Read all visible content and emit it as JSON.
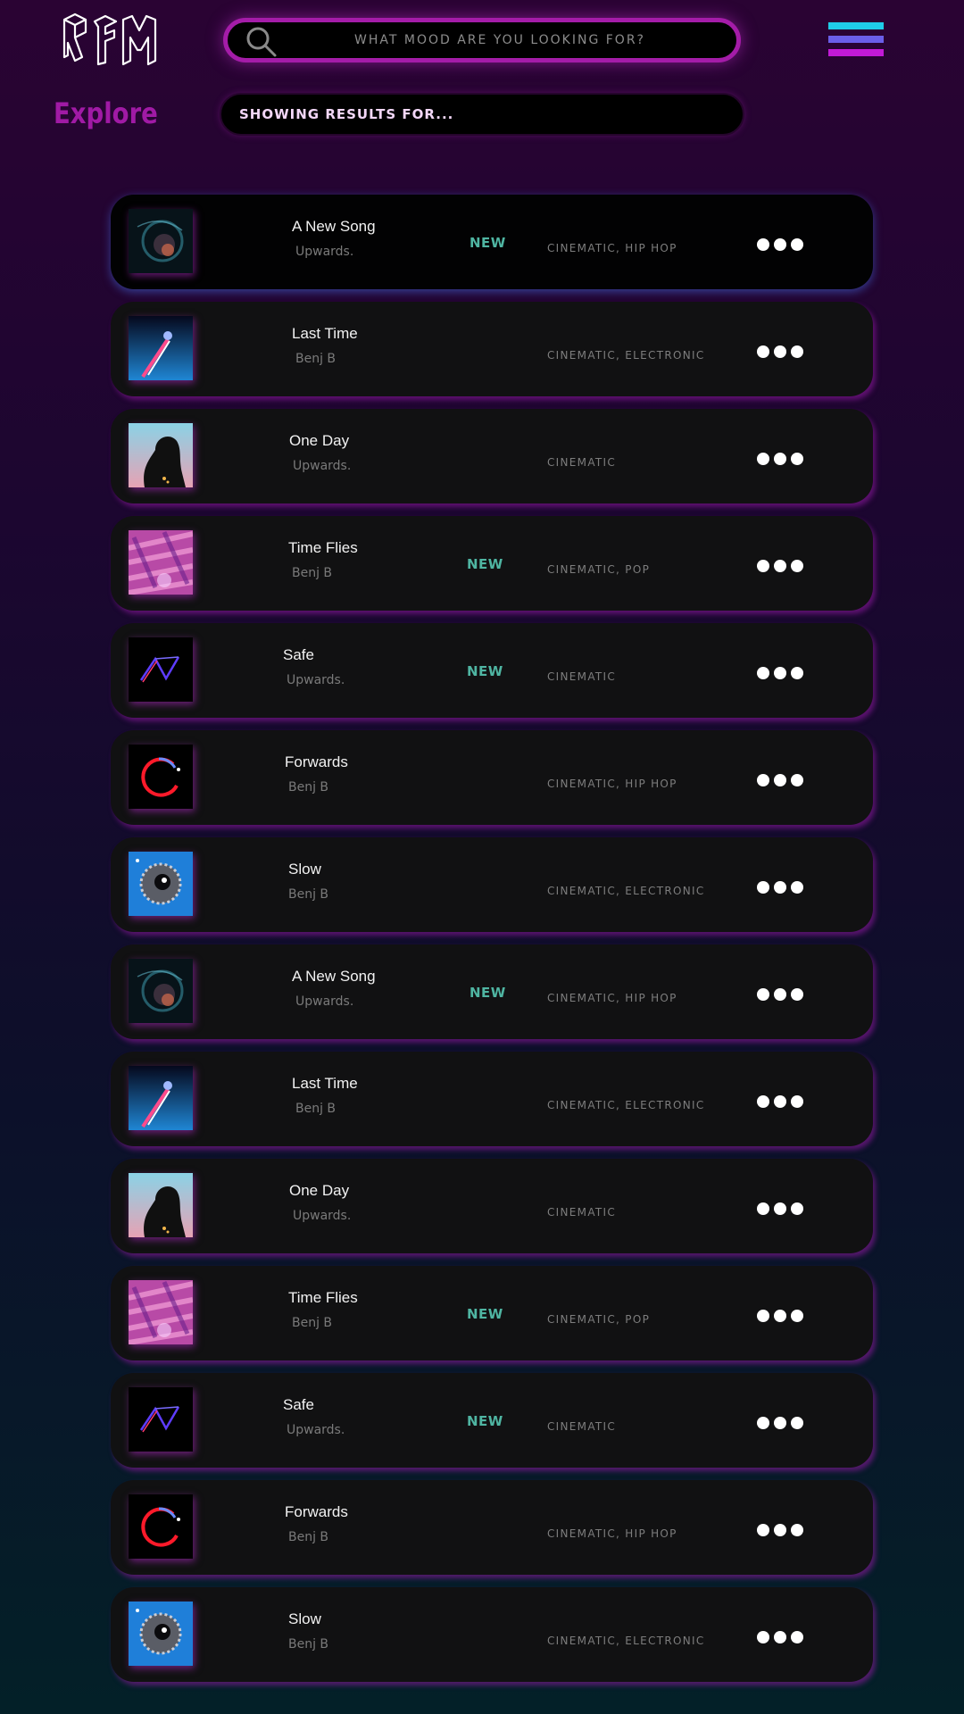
{
  "colors": {
    "accent": "#a41ca8",
    "explore_heading": "#a01aa5",
    "new_badge": "#4fb5a2",
    "menu_line_1": "#1fcde8",
    "menu_line_2": "#6a5ee8",
    "menu_line_3": "#c21ad6"
  },
  "header": {
    "logo_text": "RFM",
    "search_placeholder": "WHAT MOOD ARE YOU LOOKING FOR?",
    "menu_icon": "hamburger-menu-icon",
    "search_icon": "search-icon"
  },
  "page": {
    "title": "Explore",
    "results_label": "SHOWING RESULTS FOR..."
  },
  "tracks": [
    {
      "title": "A New Song",
      "artist": "Upwards.",
      "badge": "NEW",
      "genres": "CINEMATIC, HIP HOP",
      "cover": "blue-particle-swirl"
    },
    {
      "title": "Last Time",
      "artist": "Benj B",
      "badge": "",
      "genres": "CINEMATIC, ELECTRONIC",
      "cover": "neon-light-streak"
    },
    {
      "title": "One Day",
      "artist": "Upwards.",
      "badge": "",
      "genres": "CINEMATIC",
      "cover": "silhouette-sky"
    },
    {
      "title": "Time Flies",
      "artist": "Benj B",
      "badge": "NEW",
      "genres": "CINEMATIC, POP",
      "cover": "pink-motion-blur"
    },
    {
      "title": "Safe",
      "artist": "Upwards.",
      "badge": "NEW",
      "genres": "CINEMATIC",
      "cover": "neon-lines-dark"
    },
    {
      "title": "Forwards",
      "artist": "Benj B",
      "badge": "",
      "genres": "CINEMATIC, HIP HOP",
      "cover": "red-neon-ring"
    },
    {
      "title": "Slow",
      "artist": "Benj B",
      "badge": "",
      "genres": "CINEMATIC, ELECTRONIC",
      "cover": "blue-eye-planet"
    },
    {
      "title": "A New Song",
      "artist": "Upwards.",
      "badge": "NEW",
      "genres": "CINEMATIC, HIP HOP",
      "cover": "blue-particle-swirl"
    },
    {
      "title": "Last Time",
      "artist": "Benj B",
      "badge": "",
      "genres": "CINEMATIC, ELECTRONIC",
      "cover": "neon-light-streak"
    },
    {
      "title": "One Day",
      "artist": "Upwards.",
      "badge": "",
      "genres": "CINEMATIC",
      "cover": "silhouette-sky"
    },
    {
      "title": "Time Flies",
      "artist": "Benj B",
      "badge": "NEW",
      "genres": "CINEMATIC, POP",
      "cover": "pink-motion-blur"
    },
    {
      "title": "Safe",
      "artist": "Upwards.",
      "badge": "NEW",
      "genres": "CINEMATIC",
      "cover": "neon-lines-dark"
    },
    {
      "title": "Forwards",
      "artist": "Benj B",
      "badge": "",
      "genres": "CINEMATIC, HIP HOP",
      "cover": "red-neon-ring"
    },
    {
      "title": "Slow",
      "artist": "Benj B",
      "badge": "",
      "genres": "CINEMATIC, ELECTRONIC",
      "cover": "blue-eye-planet"
    }
  ]
}
